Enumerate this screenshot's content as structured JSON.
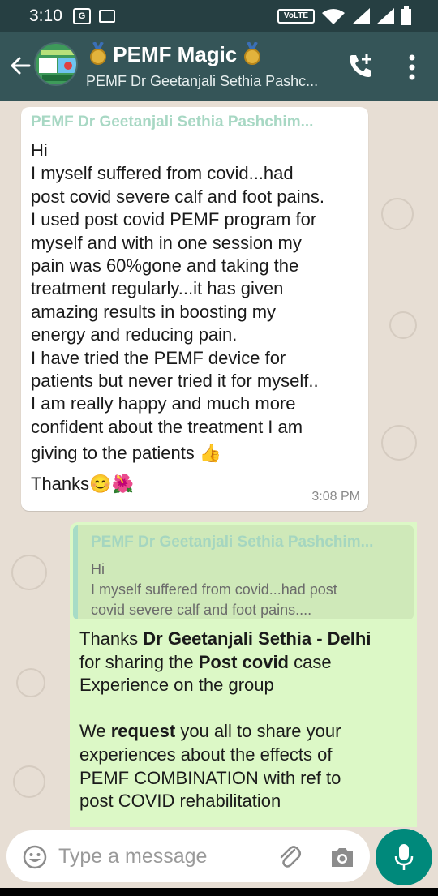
{
  "status_bar": {
    "time": "3:10",
    "network_badge": "VoLTE"
  },
  "header": {
    "title": "PEMF Magic",
    "subtitle": "PEMF Dr Geetanjali Sethia Pashc...",
    "icons": [
      "back-arrow-icon",
      "group-avatar",
      "medal-icon",
      "call-add-icon",
      "more-vert-icon"
    ]
  },
  "messages": [
    {
      "direction": "incoming",
      "sender": "PEMF Dr Geetanjali Sethia Pashchim...",
      "lines": [
        "Hi",
        "I myself suffered from covid...had",
        "post covid severe calf and foot pains.",
        "I used post covid PEMF program for",
        "myself and with in one session my",
        "pain was 60%gone and taking the",
        "treatment regularly...it has given",
        "amazing results in boosting my",
        "energy and reducing pain.",
        "I have tried the PEMF device for",
        "patients but never tried it for myself..",
        "I am really happy and much more",
        "confident about the treatment I am",
        "giving to the patients 👍",
        "Thanks😊🌺"
      ],
      "time": "3:08 PM"
    },
    {
      "direction": "outgoing",
      "quote": {
        "sender": "PEMF Dr Geetanjali Sethia Pashchim...",
        "line1": "Hi",
        "line2": "I myself suffered from covid...had post",
        "line3": "covid severe calf and foot pains...."
      },
      "segments": {
        "p1_a": "Thanks ",
        "p1_b": "Dr Geetanjali Sethia - Delhi",
        "p1_c": "for sharing the ",
        "p1_d": "Post covid",
        "p1_e": " case",
        "p1_f": "Experience on the group",
        "p2_a": "We ",
        "p2_b": "request",
        "p2_c": " you all to share your",
        "p2_d": "experiences about the effects of",
        "p2_e": "PEMF COMBINATION with ref to",
        "p2_f": "post COVID rehabilitation"
      }
    }
  ],
  "composer": {
    "placeholder": "Type a message",
    "icons": [
      "emoji-icon",
      "attach-icon",
      "camera-icon",
      "mic-icon"
    ]
  },
  "colors": {
    "app_bar": "#355558",
    "chat_bg": "#e7ded4",
    "incoming_bubble": "#ffffff",
    "outgoing_bubble": "#dcf8c6",
    "accent": "#00897b",
    "sender_name": "#a8d8c4"
  }
}
